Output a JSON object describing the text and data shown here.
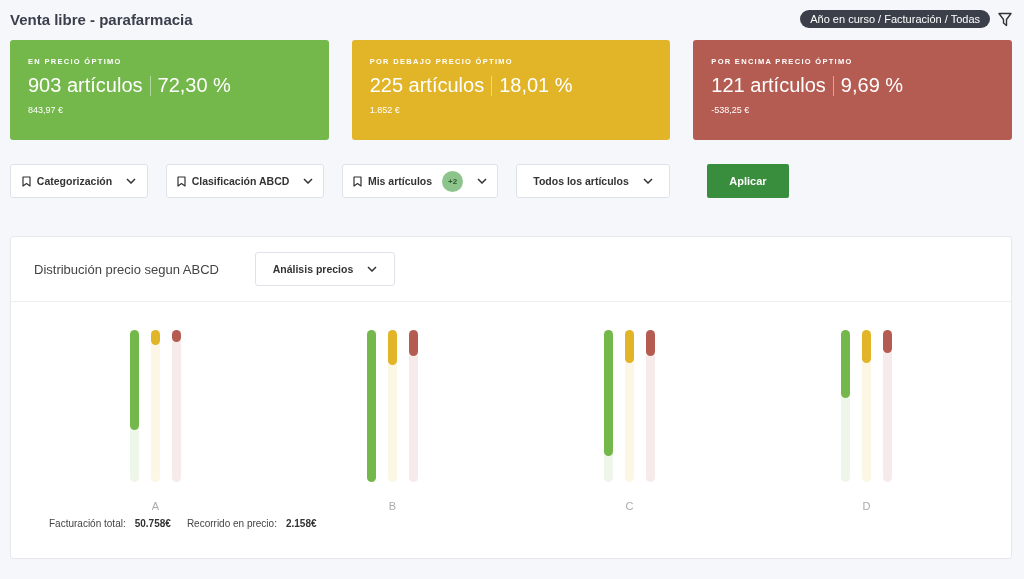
{
  "title": "Venta libre - parafarmacia",
  "context_chip": "Año en curso / Facturación / Todas",
  "cards": [
    {
      "label": "EN PRECIO ÓPTIMO",
      "count": "903 artículos",
      "percent": "72,30 %",
      "amount": "843,97 €",
      "color": "#74b74b"
    },
    {
      "label": "POR DEBAJO PRECIO ÓPTIMO",
      "count": "225 artículos",
      "percent": "18,01 %",
      "amount": "1.852 €",
      "color": "#e2b428"
    },
    {
      "label": "POR ENCIMA PRECIO ÓPTIMO",
      "count": "121 artículos",
      "percent": "9,69 %",
      "amount": "-538,25 €",
      "color": "#b45c52"
    }
  ],
  "filters": [
    {
      "label": "Categorización",
      "bookmark": true
    },
    {
      "label": "Clasificación ABCD",
      "bookmark": true
    },
    {
      "label": "Mis artículos",
      "bookmark": true,
      "badge": "+2"
    },
    {
      "label": "Todos los artículos",
      "bookmark": false
    }
  ],
  "apply_button": "Aplicar",
  "panel": {
    "title": "Distribución precio segun ABCD",
    "dropdown": "Análisis precios",
    "groups": [
      {
        "label": "A",
        "bars": [
          {
            "color": "#74b74b",
            "level": 0.66
          },
          {
            "color": "#e2b428",
            "level": 0.1
          },
          {
            "color": "#b45c52",
            "level": 0.08
          }
        ]
      },
      {
        "label": "B",
        "bars": [
          {
            "color": "#74b74b",
            "level": 1.0
          },
          {
            "color": "#e2b428",
            "level": 0.23
          },
          {
            "color": "#b45c52",
            "level": 0.17
          }
        ]
      },
      {
        "label": "C",
        "bars": [
          {
            "color": "#74b74b",
            "level": 0.83
          },
          {
            "color": "#e2b428",
            "level": 0.22
          },
          {
            "color": "#b45c52",
            "level": 0.17
          }
        ]
      },
      {
        "label": "D",
        "bars": [
          {
            "color": "#74b74b",
            "level": 0.45
          },
          {
            "color": "#e2b428",
            "level": 0.22
          },
          {
            "color": "#b45c52",
            "level": 0.15
          }
        ]
      }
    ],
    "footer": [
      {
        "label": "Facturación total:",
        "value": "50.758€"
      },
      {
        "label": "Recorrido en precio:",
        "value": "2.158€"
      }
    ]
  }
}
